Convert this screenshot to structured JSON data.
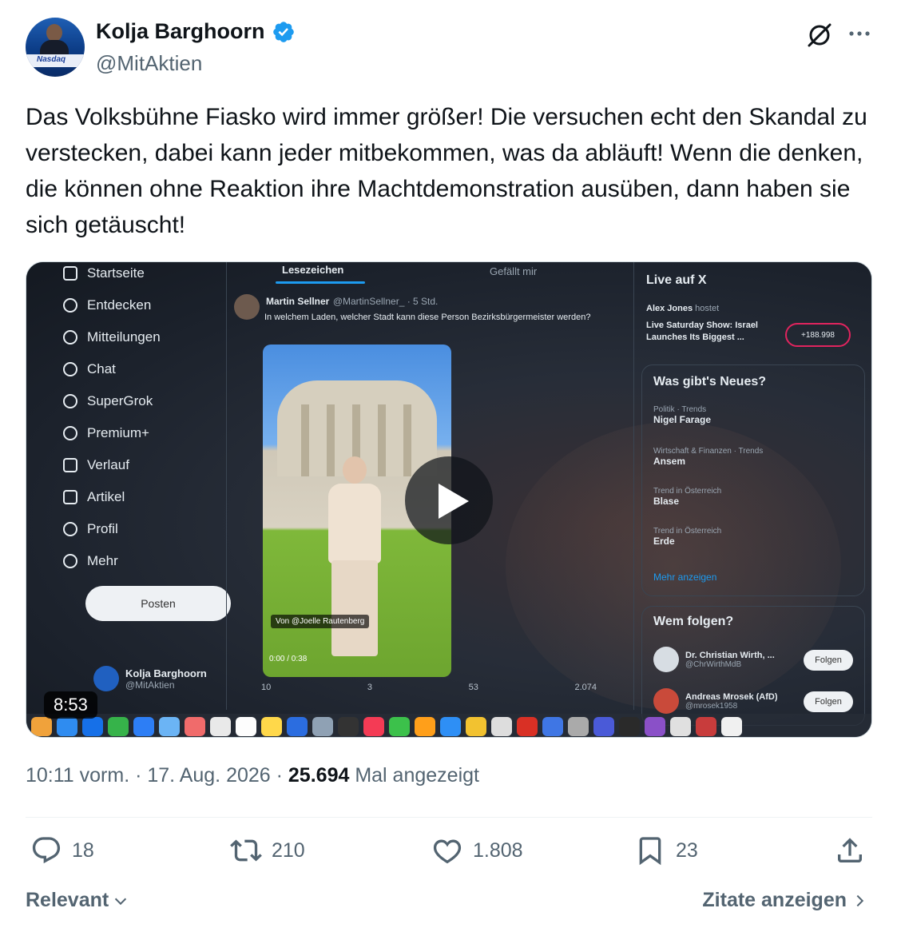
{
  "author": {
    "name": "Kolja Barghoorn",
    "handle": "@MitAktien",
    "avatar_text": "Nasdaq"
  },
  "tweet": {
    "text": "Das Volksbühne Fiasko wird immer größer! Die versuchen echt den Skandal zu verstecken, dabei kann jeder mitbekommen, was da abläuft! Wenn die denken, die können ohne Reaktion ihre Machtdemonstration ausüben, dann haben sie sich getäuscht!"
  },
  "video": {
    "duration": "8:53",
    "screen": {
      "nav": [
        "Startseite",
        "Entdecken",
        "Mitteilungen",
        "Chat",
        "SuperGrok",
        "Premium+",
        "Verlauf",
        "Artikel",
        "Profil",
        "Mehr"
      ],
      "post_button": "Posten",
      "profile_name": "Kolja Barghoorn",
      "profile_handle": "@MitAktien",
      "tab_active": "Lesezeichen",
      "tab_other": "Gefällt mir",
      "inner_author": "Martin Sellner",
      "inner_handle": "@MartinSellner_ · 5 Std.",
      "inner_text": "In welchem Laden, welcher Stadt kann diese Person Bezirksbürgermeister werden?",
      "video_credit": "Von @Joelle Rautenberg",
      "video_time": "0:00 / 0:38",
      "inner_counts": [
        "10",
        "3",
        "53",
        "2.074"
      ],
      "live_title": "Live auf X",
      "live_host": "Alex Jones",
      "live_host_suffix": "hostet",
      "live_show": "Live Saturday Show: Israel Launches Its Biggest ...",
      "live_count": "+188.998",
      "news_title": "Was gibt's Neues?",
      "trends": [
        {
          "cat": "Politik · Trends",
          "name": "Nigel Farage"
        },
        {
          "cat": "Wirtschaft & Finanzen · Trends",
          "name": "Ansem"
        },
        {
          "cat": "Trend in Österreich",
          "name": "Blase"
        },
        {
          "cat": "Trend in Österreich",
          "name": "Erde"
        }
      ],
      "more_link": "Mehr anzeigen",
      "follow_title": "Wem folgen?",
      "follows": [
        {
          "name": "Dr. Christian Wirth, ...",
          "handle": "@ChrWirthMdB",
          "button": "Folgen"
        },
        {
          "name": "Andreas Mrosek (AfD)",
          "handle": "@mrosek1958",
          "button": "Folgen"
        }
      ]
    }
  },
  "meta": {
    "time": "10:11 vorm.",
    "date": "17. Aug. 2026",
    "views": "25.694",
    "views_label": "Mal angezeigt"
  },
  "actions": {
    "replies": "18",
    "reposts": "210",
    "likes": "1.808",
    "bookmarks": "23"
  },
  "footer": {
    "sort_label": "Relevant",
    "quotes_label": "Zitate anzeigen"
  },
  "colors": {
    "text": "#0f1419",
    "secondary": "#536471",
    "verified": "#1d9bf0",
    "divider": "#eff3f4"
  }
}
